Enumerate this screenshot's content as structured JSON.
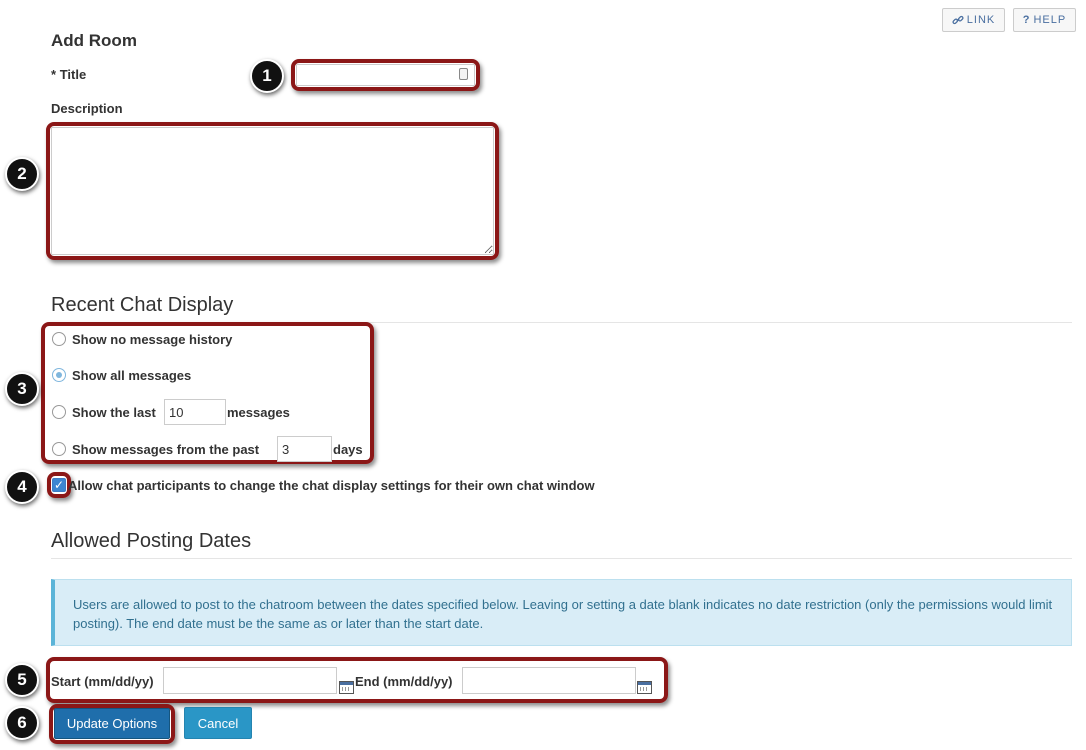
{
  "toolbar": {
    "link_label": "LINK",
    "link_icon": "link-icon",
    "help_label": "HELP",
    "help_icon": "question-icon"
  },
  "form": {
    "heading": "Add Room",
    "title_required": "*",
    "title_label": "Title",
    "title_value": "",
    "description_label": "Description",
    "description_value": ""
  },
  "recent_chat": {
    "heading": "Recent Chat Display",
    "options": [
      {
        "label": "Show no message history",
        "selected": false
      },
      {
        "label": "Show all messages",
        "selected": true
      },
      {
        "label_before": "Show the last",
        "value": "10",
        "label_after": "messages",
        "selected": false
      },
      {
        "label_before": "Show messages from the past",
        "value": "3",
        "label_after": "days",
        "selected": false
      }
    ],
    "allow_change_label": "Allow chat participants to change the chat display settings for their own chat window",
    "allow_change_checked": true
  },
  "posting_dates": {
    "heading": "Allowed Posting Dates",
    "info": "Users are allowed to post to the chatroom between the dates specified below. Leaving or setting a date blank indicates no date restriction (only the permissions would limit posting). The end date must be the same as or later than the start date.",
    "start_label": "Start (mm/dd/yy)",
    "start_value": "",
    "end_label": "End (mm/dd/yy)",
    "end_value": ""
  },
  "actions": {
    "update_label": "Update Options",
    "cancel_label": "Cancel"
  },
  "callouts": [
    "1",
    "2",
    "3",
    "4",
    "5",
    "6"
  ],
  "colors": {
    "callout_frame": "#8b1717",
    "primary_button": "#1f6eab",
    "secondary_button": "#2a96c6",
    "info_background": "#d9edf7",
    "info_text": "#31708f"
  }
}
